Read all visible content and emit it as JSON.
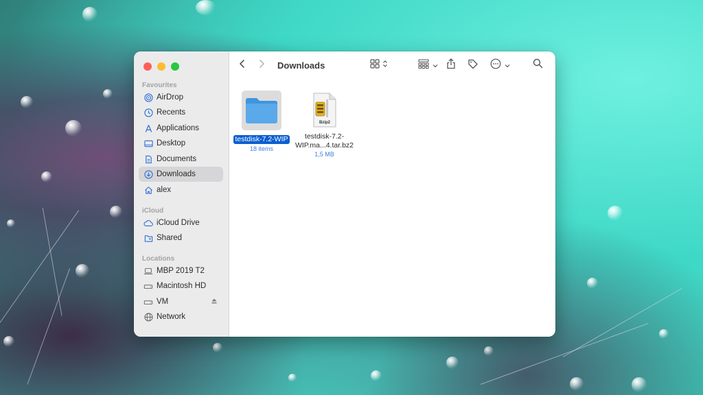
{
  "window": {
    "title": "Downloads"
  },
  "sidebar": {
    "sections": [
      {
        "title": "Favourites",
        "items": [
          {
            "label": "AirDrop",
            "icon": "airdrop-icon"
          },
          {
            "label": "Recents",
            "icon": "clock-icon"
          },
          {
            "label": "Applications",
            "icon": "applications-icon"
          },
          {
            "label": "Desktop",
            "icon": "desktop-icon"
          },
          {
            "label": "Documents",
            "icon": "document-icon"
          },
          {
            "label": "Downloads",
            "icon": "download-icon",
            "selected": true
          },
          {
            "label": "alex",
            "icon": "home-icon"
          }
        ]
      },
      {
        "title": "iCloud",
        "items": [
          {
            "label": "iCloud Drive",
            "icon": "cloud-icon"
          },
          {
            "label": "Shared",
            "icon": "shared-folder-icon"
          }
        ]
      },
      {
        "title": "Locations",
        "items": [
          {
            "label": "MBP 2019 T2",
            "icon": "laptop-icon"
          },
          {
            "label": "Macintosh HD",
            "icon": "disk-icon"
          },
          {
            "label": "VM",
            "icon": "disk-icon",
            "ejectable": true
          },
          {
            "label": "Network",
            "icon": "globe-icon"
          }
        ]
      }
    ]
  },
  "files": [
    {
      "name": "testdisk-7.2-WIP",
      "meta": "18 items",
      "kind": "folder",
      "selected": true
    },
    {
      "name_line1": "testdisk-7.2-",
      "name_line2": "WIP.ma...4.tar.bz2",
      "meta": "1,5 MB",
      "kind": "bzip2-archive",
      "badge": "Bzip2"
    }
  ],
  "colors": {
    "accent": "#0a5fd0",
    "folder": "#5aa9ea",
    "close": "#ff5f57",
    "minimize": "#febc2e",
    "zoom": "#28c840"
  }
}
